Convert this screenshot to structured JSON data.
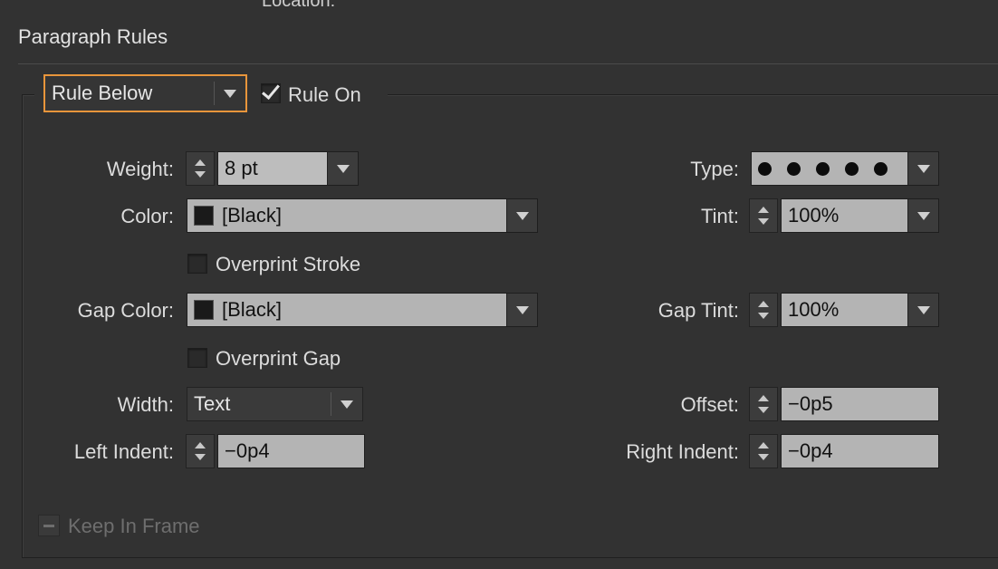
{
  "top_cut_label": "Location:",
  "section_title": "Paragraph Rules",
  "rule_type": {
    "value": "Rule Below"
  },
  "rule_on": {
    "label": "Rule On",
    "checked": true
  },
  "weight": {
    "label": "Weight:",
    "value": "8 pt"
  },
  "type": {
    "label": "Type:",
    "pattern": "dots"
  },
  "color": {
    "label": "Color:",
    "value": "[Black]",
    "swatch": "#1a1a1a"
  },
  "tint": {
    "label": "Tint:",
    "value": "100%"
  },
  "overprint_stroke": {
    "label": "Overprint Stroke",
    "checked": false
  },
  "gap_color": {
    "label": "Gap Color:",
    "value": "[Black]",
    "swatch": "#1a1a1a"
  },
  "gap_tint": {
    "label": "Gap Tint:",
    "value": "100%"
  },
  "overprint_gap": {
    "label": "Overprint Gap",
    "checked": false
  },
  "width": {
    "label": "Width:",
    "value": "Text"
  },
  "offset": {
    "label": "Offset:",
    "value": "−0p5"
  },
  "left_indent": {
    "label": "Left Indent:",
    "value": "−0p4"
  },
  "right_indent": {
    "label": "Right Indent:",
    "value": "−0p4"
  },
  "keep_in_frame": {
    "label": "Keep In Frame",
    "state": "mixed",
    "disabled": true
  },
  "colors": {
    "accent_focus": "#e8953b",
    "panel": "#323232",
    "field": "#b4b4b4"
  }
}
